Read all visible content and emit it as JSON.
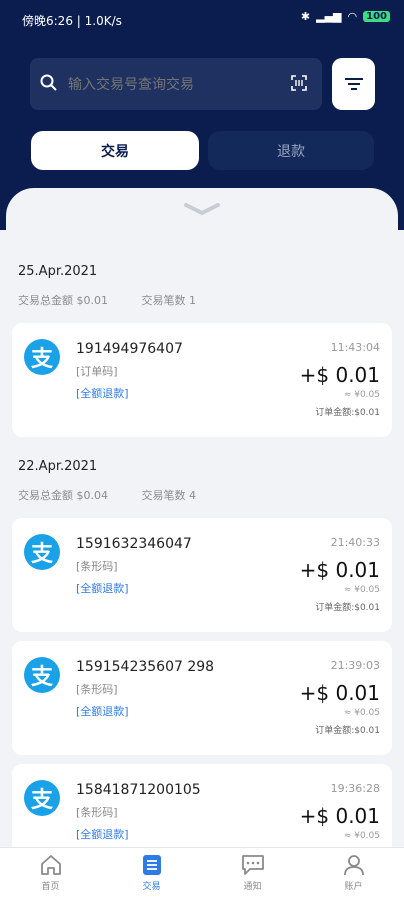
{
  "status_bar": {
    "time_text": "傍晚6:26 | 1.0K/s",
    "battery": "100"
  },
  "search": {
    "placeholder": "输入交易号查询交易"
  },
  "tabs": [
    {
      "label": "交易"
    },
    {
      "label": "退款"
    }
  ],
  "groups": [
    {
      "date": "25.Apr.2021",
      "total_label": "交易总金额 $0.01",
      "count_label": "交易笔数 1",
      "transactions": [
        {
          "id": "191494976407",
          "type": "[订单码]",
          "refund": "[全额退款]",
          "time": "11:43:04",
          "amount": "+$ 0.01",
          "rmb": "≈ ¥0.05",
          "order": "订单金额:$0.01"
        }
      ]
    },
    {
      "date": "22.Apr.2021",
      "total_label": "交易总金额 $0.04",
      "count_label": "交易笔数 4",
      "transactions": [
        {
          "id": "1591632346047",
          "type": "[条形码]",
          "refund": "[全额退款]",
          "time": "21:40:33",
          "amount": "+$ 0.01",
          "rmb": "≈ ¥0.05",
          "order": "订单金额:$0.01"
        },
        {
          "id": "159154235607 298",
          "type": "[条形码]",
          "refund": "[全额退款]",
          "time": "21:39:03",
          "amount": "+$ 0.01",
          "rmb": "≈ ¥0.05",
          "order": "订单金额:$0.01"
        },
        {
          "id": "15841871200105",
          "type": "[条形码]",
          "refund": "[全额退款]",
          "time": "19:36:28",
          "amount": "+$ 0.01",
          "rmb": "≈ ¥0.05",
          "order": ""
        }
      ]
    }
  ],
  "nav": [
    {
      "label": "首页",
      "icon": "home-icon"
    },
    {
      "label": "交易",
      "icon": "list-icon"
    },
    {
      "label": "通知",
      "icon": "message-icon"
    },
    {
      "label": "账户",
      "icon": "user-icon"
    }
  ],
  "colors": {
    "header": "#0b1d4f",
    "accent": "#2f7be5",
    "alipay": "#1aa1e8"
  }
}
